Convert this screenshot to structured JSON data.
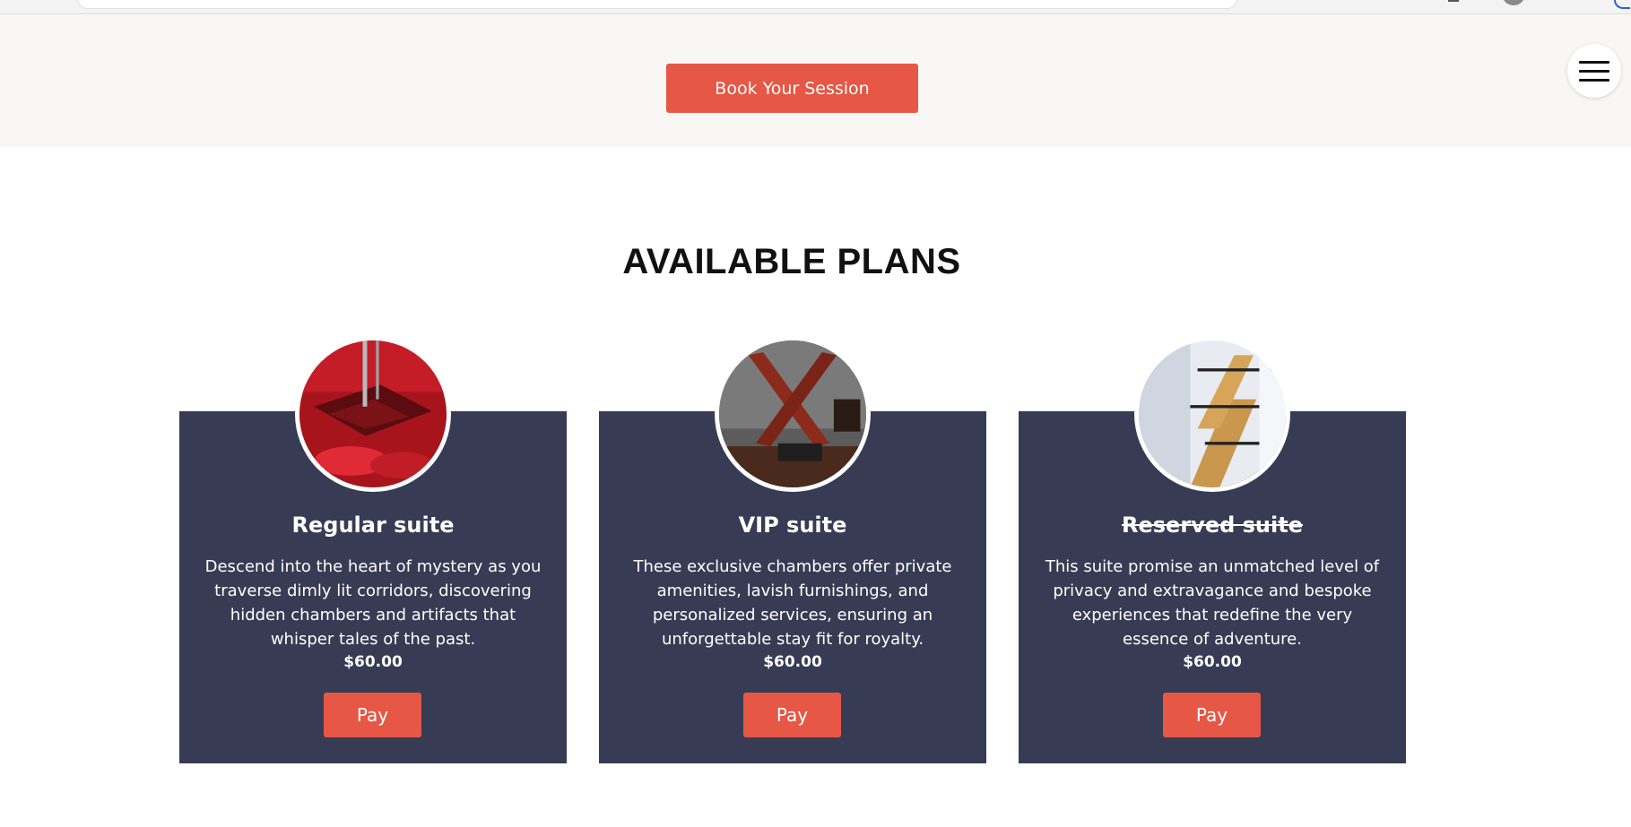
{
  "hero": {
    "book_label": "Book Your Session"
  },
  "plans_section": {
    "title": "AVAILABLE PLANS"
  },
  "plans": [
    {
      "name": "Regular suite",
      "description": "Descend into the heart of mystery as you traverse dimly lit corridors, discovering hidden chambers and artifacts that whisper tales of the past.",
      "price": "$60.00",
      "pay_label": "Pay",
      "name_struck": false
    },
    {
      "name": "VIP suite",
      "description": "These exclusive chambers offer private amenities, lavish furnishings, and personalized services, ensuring an unforgettable stay fit for royalty.",
      "price": "$60.00",
      "pay_label": "Pay",
      "name_struck": false
    },
    {
      "name": "Reserved suite",
      "description": "This suite promise an unmatched level of privacy and extravagance and bespoke experiences that redefine the very essence of adventure.",
      "price": "$60.00",
      "pay_label": "Pay",
      "name_struck": true
    }
  ],
  "colors": {
    "accent": "#e65746",
    "card_bg": "#373c54",
    "hero_bg": "#f8f7f5"
  },
  "icons": {
    "menu": "hamburger-menu-icon"
  }
}
